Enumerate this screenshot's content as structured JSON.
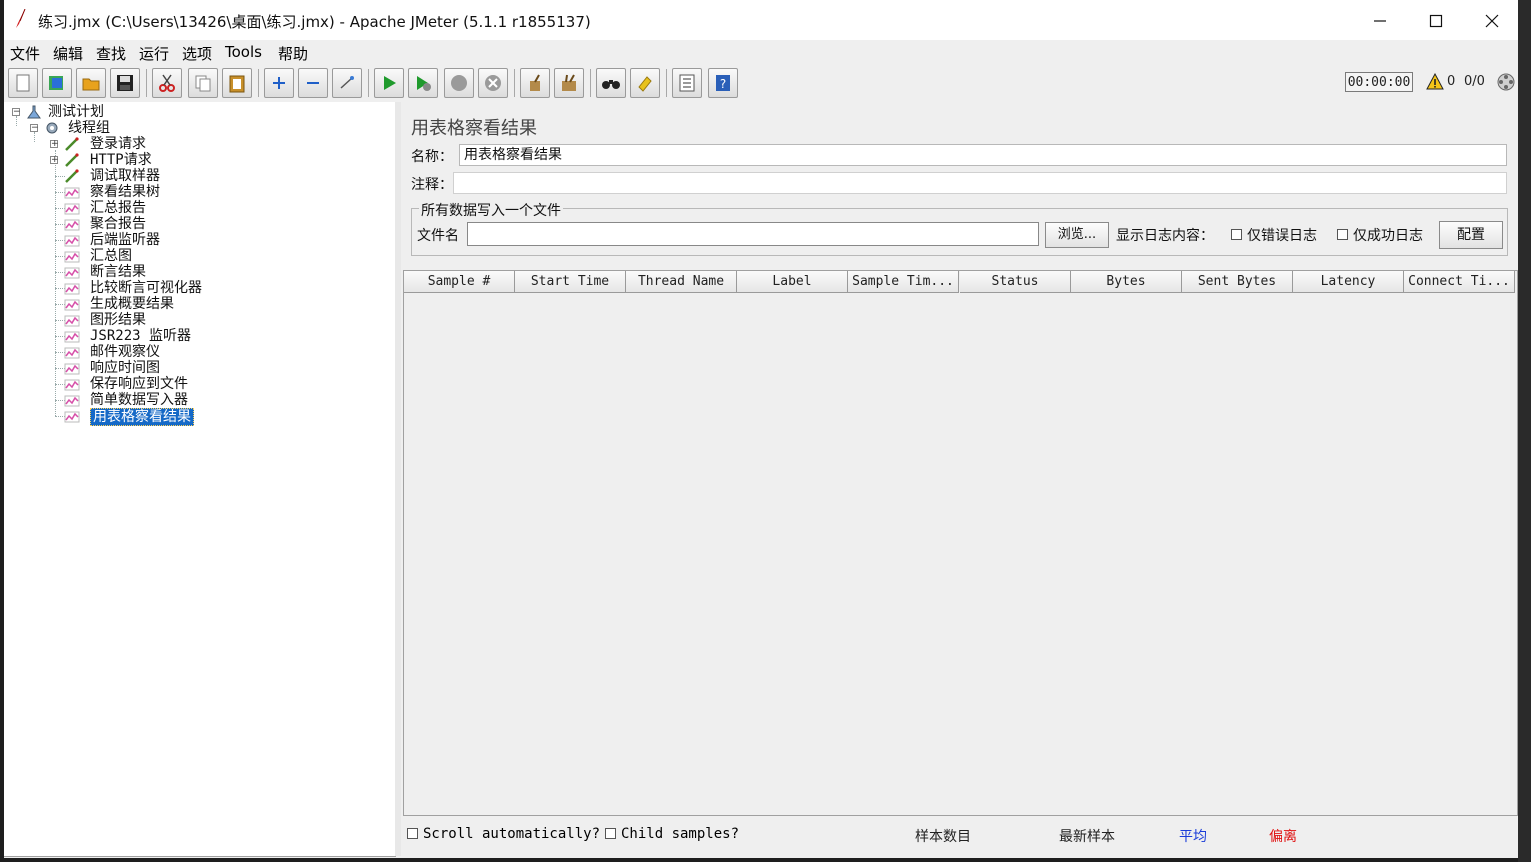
{
  "window": {
    "title": "练习.jmx (C:\\Users\\13426\\桌面\\练习.jmx) - Apache JMeter (5.1.1 r1855137)"
  },
  "menu": [
    "文件",
    "编辑",
    "查找",
    "运行",
    "选项",
    "Tools",
    "帮助"
  ],
  "toolbar": {
    "buttons": [
      "new",
      "templates",
      "open",
      "save",
      "cut",
      "copy",
      "paste",
      "expand",
      "collapse",
      "toggle",
      "start",
      "start-no-pauses",
      "stop",
      "shutdown",
      "clear",
      "clear-all",
      "search",
      "reset-search",
      "function-helper",
      "help"
    ],
    "timer": "00:00:00",
    "warning_count": "0",
    "threads": "0/0"
  },
  "tree": {
    "root": "测试计划",
    "thread_group": "线程组",
    "items": [
      {
        "label": "登录请求",
        "icon": "sampler-icon",
        "expandable": true
      },
      {
        "label": "HTTP请求",
        "icon": "sampler-icon",
        "expandable": true
      },
      {
        "label": "调试取样器",
        "icon": "sampler-icon",
        "expandable": false
      },
      {
        "label": "察看结果树",
        "icon": "listener-icon",
        "expandable": false
      },
      {
        "label": "汇总报告",
        "icon": "listener-icon",
        "expandable": false
      },
      {
        "label": "聚合报告",
        "icon": "listener-icon",
        "expandable": false
      },
      {
        "label": "后端监听器",
        "icon": "listener-icon",
        "expandable": false
      },
      {
        "label": "汇总图",
        "icon": "listener-icon",
        "expandable": false
      },
      {
        "label": "断言结果",
        "icon": "listener-icon",
        "expandable": false
      },
      {
        "label": "比较断言可视化器",
        "icon": "listener-icon",
        "expandable": false
      },
      {
        "label": "生成概要结果",
        "icon": "listener-icon",
        "expandable": false
      },
      {
        "label": "图形结果",
        "icon": "listener-icon",
        "expandable": false
      },
      {
        "label": "JSR223 监听器",
        "icon": "listener-icon",
        "expandable": false
      },
      {
        "label": "邮件观察仪",
        "icon": "listener-icon",
        "expandable": false
      },
      {
        "label": "响应时间图",
        "icon": "listener-icon",
        "expandable": false
      },
      {
        "label": "保存响应到文件",
        "icon": "listener-icon",
        "expandable": false
      },
      {
        "label": "简单数据写入器",
        "icon": "listener-icon",
        "expandable": false
      },
      {
        "label": "用表格察看结果",
        "icon": "listener-icon",
        "expandable": false,
        "selected": true
      }
    ]
  },
  "panel": {
    "title": "用表格察看结果",
    "name_label": "名称：",
    "name_value": "用表格察看结果",
    "comment_label": "注释：",
    "comment_value": "",
    "file_group_title": "所有数据写入一个文件",
    "filename_label": "文件名",
    "filename_value": "",
    "browse_button": "浏览...",
    "log_label": "显示日志内容：",
    "errors_only": "仅错误日志",
    "success_only": "仅成功日志",
    "configure_button": "配置"
  },
  "table": {
    "columns": [
      "Sample #",
      "Start Time",
      "Thread Name",
      "Label",
      "Sample Tim...",
      "Status",
      "Bytes",
      "Sent Bytes",
      "Latency",
      "Connect Ti..."
    ]
  },
  "footer": {
    "scroll_auto": "Scroll automatically?",
    "child_samples": "Child samples?",
    "sample_count_label": "样本数目",
    "latest_sample_label": "最新样本",
    "average_label": "平均",
    "deviation_label": "偏离",
    "average_color": "#1a3cd8",
    "deviation_color": "#e01010"
  }
}
